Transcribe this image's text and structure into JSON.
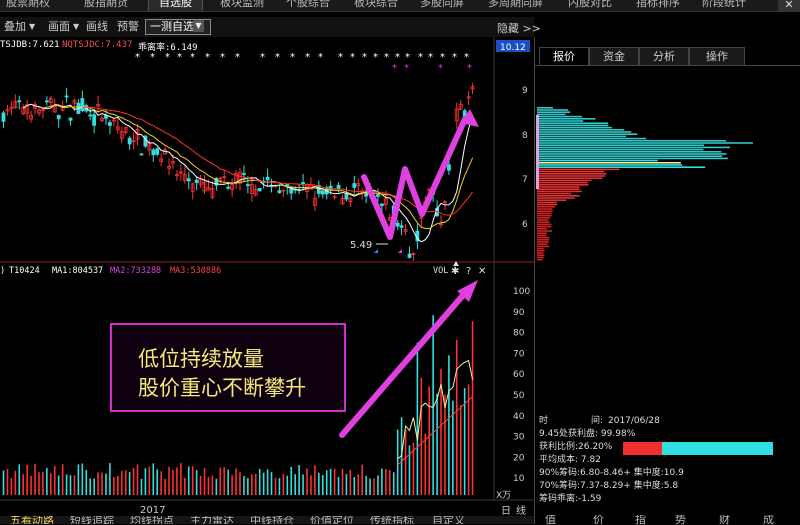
{
  "top_tabs": [
    "股票期权",
    "股指期货",
    "自选股",
    "板块监测",
    "个股综合",
    "板块综合",
    "多股同屏",
    "多周期同屏",
    "内股对比",
    "指标排序",
    "阶段统计"
  ],
  "active_tab_index": 2,
  "window_close": "✕",
  "toolbar": {
    "overlay": "叠加",
    "draw": "画面",
    "line": "画线",
    "alert": "预警",
    "selection": "一测自选",
    "hide": "隐藏",
    "more": ">>"
  },
  "indicator_main": {
    "a": "TSJDB:7.621",
    "b": "NQTSJDC:7.437",
    "c": "乖离率:6.149"
  },
  "indicator_vol": {
    "pre": ")",
    "v": "T10424",
    "ma1": "MA1:804537",
    "ma2": "MA2:733288",
    "ma3": "MA3:530886",
    "vol_label": "VOL"
  },
  "price_axis": {
    "top_price": "10.12",
    "ticks": [
      "9",
      "8",
      "7",
      "6"
    ]
  },
  "low_price_label": "5.49",
  "vol_axis": {
    "ticks": [
      "100",
      "90",
      "80",
      "70",
      "60",
      "50",
      "40",
      "30",
      "20",
      "10"
    ],
    "unit": "X万"
  },
  "x_axis": {
    "year": "2017",
    "day_label": "日",
    "line_label": "线"
  },
  "annotation": {
    "line1": "低位持续放量",
    "line2": "股价重心不断攀升"
  },
  "right_tabs": [
    "报价",
    "资金",
    "分析",
    "操作"
  ],
  "right_active": 0,
  "stats": {
    "time_label": "时",
    "time_gap": "间:",
    "date": "2017/06/28",
    "profit_disk": "9.45处获利盘: 99.98%",
    "profit_ratio": "获利比例:26.20%",
    "avg_cost": "平均成本: 7.82",
    "chip90": "90%筹码:6.80-8.46+ 集中度:10.9",
    "chip70": "70%筹码:7.37-8.29+ 集中度:5.8",
    "deviation": "筹码乖离:-1.59"
  },
  "profit_ratio_value": 26.2,
  "bottom_tabs": [
    "五看动路",
    "短线追踪",
    "均线拐点",
    "主力雷达",
    "中线持仓",
    "价值定位",
    "传统指标",
    "自定义"
  ],
  "bottom_right_tabs": [
    "值",
    "价",
    "指",
    "势",
    "财",
    "成"
  ],
  "chart_data": [
    {
      "type": "candlestick",
      "title": "",
      "ylim": [
        5,
        10.5
      ],
      "low_marker": 5.49
    },
    {
      "type": "bar",
      "title": "VOL",
      "ylim": [
        0,
        105
      ],
      "unit": "X万"
    },
    {
      "type": "bar",
      "title": "",
      "orientation": "horizontal",
      "ylim": [
        5.5,
        9.5
      ],
      "note": "chip distribution"
    }
  ],
  "colors": {
    "up": "#ff3030",
    "down": "#30e0e0",
    "accent": "#e040e0",
    "text_yellow": "#f5e97a"
  }
}
